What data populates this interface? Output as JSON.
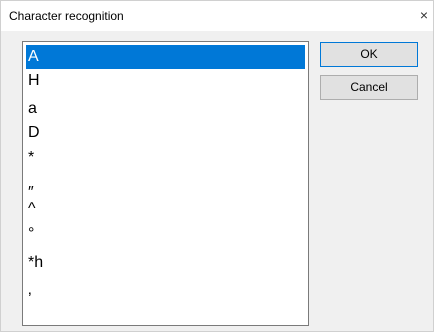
{
  "window": {
    "title": "Character recognition",
    "close_glyph": "×"
  },
  "list": {
    "selected_index": 0,
    "items": [
      {
        "label": "A"
      },
      {
        "label": "H"
      },
      {
        "label": "a"
      },
      {
        "label": "D"
      },
      {
        "label": "*"
      },
      {
        "label": ""
      },
      {
        "label": "″"
      },
      {
        "label": "^"
      },
      {
        "label": "°"
      },
      {
        "label": "*h"
      },
      {
        "label": "‚"
      }
    ]
  },
  "buttons": {
    "ok_label": "OK",
    "cancel_label": "Cancel"
  }
}
